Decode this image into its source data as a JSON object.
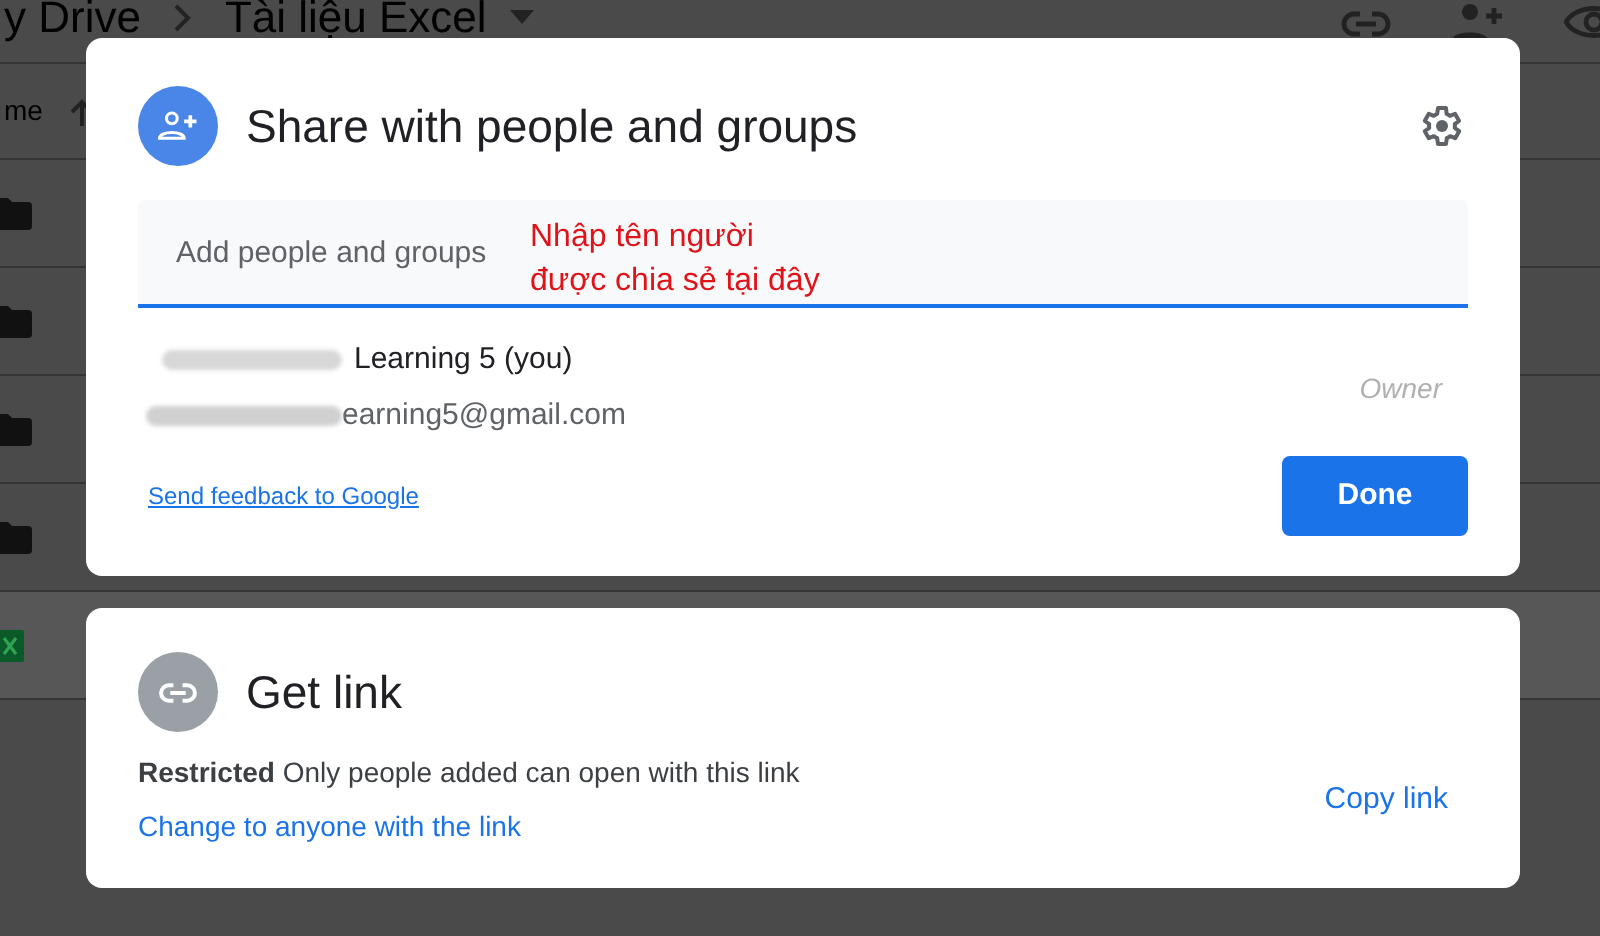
{
  "drive": {
    "breadcrumb": [
      "y Drive",
      "Tài liệu Excel"
    ],
    "column_header": "me",
    "rows": [
      {
        "kind": "folder",
        "selected": false
      },
      {
        "kind": "folder",
        "selected": false
      },
      {
        "kind": "folder",
        "selected": false
      },
      {
        "kind": "folder",
        "selected": false
      },
      {
        "kind": "sheet",
        "selected": true
      }
    ]
  },
  "share_dialog": {
    "title": "Share with people and groups",
    "search": {
      "placeholder": "Add people and groups"
    },
    "annotation": [
      "Nhập tên người",
      "được chia sẻ tại đây"
    ],
    "people": [
      {
        "name": "Learning 5 (you)",
        "email": "earning5@gmail.com",
        "role": "Owner"
      }
    ],
    "feedback_link": "Send feedback to Google",
    "done_button": "Done"
  },
  "link_dialog": {
    "title": "Get link",
    "access": "**Restricted** Only people added can open with this link",
    "change_link": "Change to anyone with the link",
    "copy_link": "Copy link"
  }
}
